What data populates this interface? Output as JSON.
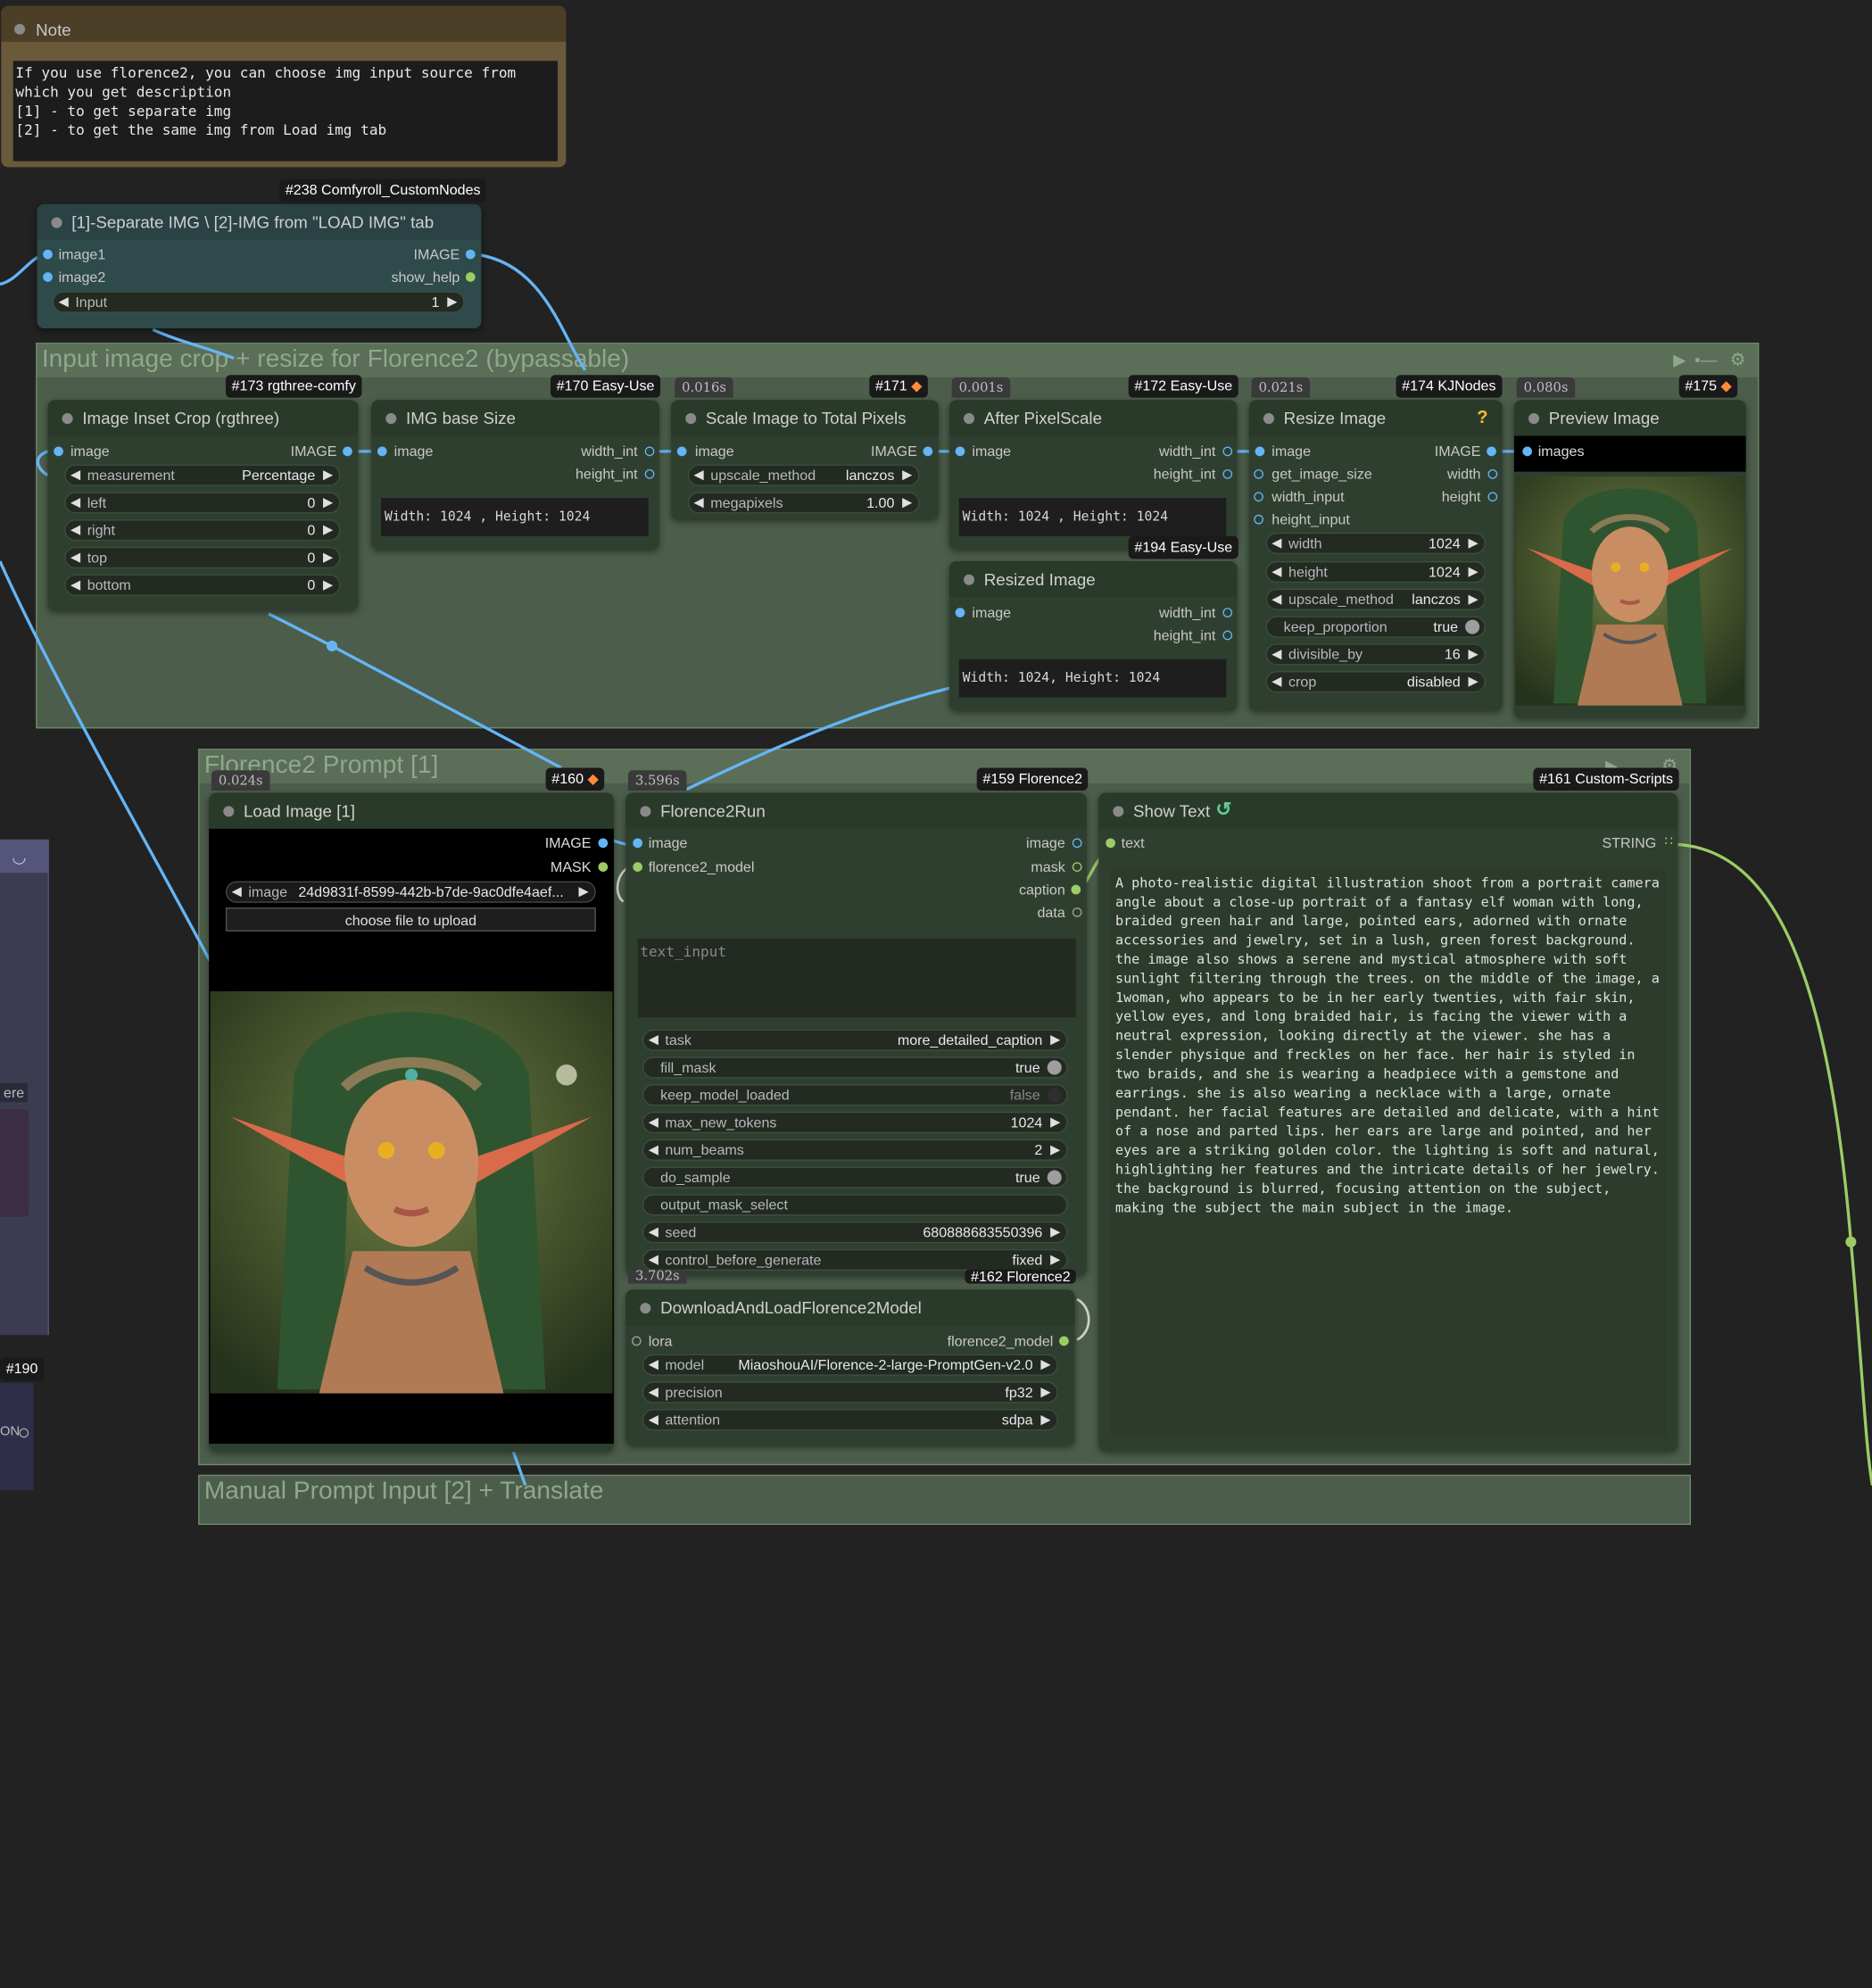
{
  "note": {
    "title": "Note",
    "text": "If you use florence2, you can choose img input source from\nwhich you get description\n[1] - to get separate img\n[2] - to get the same img from Load img tab"
  },
  "switch_node": {
    "badge": "#238 Comfyroll_CustomNodes",
    "title": "[1]-Separate IMG \\ [2]-IMG from \"LOAD IMG\" tab",
    "inputs": [
      "image1",
      "image2"
    ],
    "outputs": [
      "IMAGE",
      "show_help"
    ],
    "widget": {
      "label": "Input",
      "value": "1"
    }
  },
  "group_crop": {
    "title": "Input image crop + resize for Florence2 (bypassable)"
  },
  "group_florence": {
    "title": "Florence2 Prompt [1]"
  },
  "group_bottom": {
    "title": "Manual Prompt Input [2] + Translate"
  },
  "inset_crop": {
    "badge": "#173 rgthree-comfy",
    "title": "Image Inset Crop (rgthree)",
    "input": "image",
    "output": "IMAGE",
    "widgets": [
      {
        "label": "measurement",
        "value": "Percentage"
      },
      {
        "label": "left",
        "value": "0"
      },
      {
        "label": "right",
        "value": "0"
      },
      {
        "label": "top",
        "value": "0"
      },
      {
        "label": "bottom",
        "value": "0"
      }
    ]
  },
  "img_base_size": {
    "badge": "#170 Easy-Use",
    "title": "IMG base Size",
    "input": "image",
    "outputs": [
      "width_int",
      "height_int"
    ],
    "text": "Width: 1024 , Height: 1024"
  },
  "scale_total": {
    "time": "0.016s",
    "badge": "#171",
    "title": "Scale Image to Total Pixels",
    "input": "image",
    "output": "IMAGE",
    "widgets": [
      {
        "label": "upscale_method",
        "value": "lanczos"
      },
      {
        "label": "megapixels",
        "value": "1.00"
      }
    ]
  },
  "after_pixelscale": {
    "time": "0.001s",
    "badge": "#172 Easy-Use",
    "title": "After PixelScale",
    "input": "image",
    "outputs": [
      "width_int",
      "height_int"
    ],
    "text": "Width: 1024 , Height: 1024"
  },
  "resized_image": {
    "badge": "#194 Easy-Use",
    "title": "Resized Image",
    "input": "image",
    "outputs": [
      "width_int",
      "height_int"
    ],
    "text": "Width: 1024, Height: 1024"
  },
  "resize_image": {
    "time": "0.021s",
    "badge": "#174 KJNodes",
    "title": "Resize Image",
    "help": "?",
    "inputs": [
      "image",
      "get_image_size",
      "width_input",
      "height_input"
    ],
    "outputs": [
      "IMAGE",
      "width",
      "height"
    ],
    "widgets": [
      {
        "label": "width",
        "value": "1024"
      },
      {
        "label": "height",
        "value": "1024"
      },
      {
        "label": "upscale_method",
        "value": "lanczos"
      },
      {
        "label": "keep_proportion",
        "value": "true"
      },
      {
        "label": "divisible_by",
        "value": "16"
      },
      {
        "label": "crop",
        "value": "disabled"
      }
    ]
  },
  "preview_image": {
    "time": "0.080s",
    "badge": "#175",
    "title": "Preview Image",
    "input": "images"
  },
  "load_image": {
    "time": "0.024s",
    "badge": "#160",
    "title": "Load Image [1]",
    "outputs": [
      "IMAGE",
      "MASK"
    ],
    "image_widget": {
      "label": "image",
      "value": "24d9831f-8599-442b-b7de-9ac0dfe4aef..."
    },
    "upload_label": "choose file to upload"
  },
  "florence_run": {
    "time": "3.596s",
    "badge": "#159 Florence2",
    "title": "Florence2Run",
    "inputs": [
      "image",
      "florence2_model"
    ],
    "outputs": [
      "image",
      "mask",
      "caption",
      "data"
    ],
    "text_placeholder": "text_input",
    "widgets": [
      {
        "label": "task",
        "value": "more_detailed_caption"
      },
      {
        "label": "fill_mask",
        "value": "true"
      },
      {
        "label": "keep_model_loaded",
        "value": "false"
      },
      {
        "label": "max_new_tokens",
        "value": "1024"
      },
      {
        "label": "num_beams",
        "value": "2"
      },
      {
        "label": "do_sample",
        "value": "true"
      },
      {
        "label": "output_mask_select",
        "value": ""
      },
      {
        "label": "seed",
        "value": "680888683550396"
      },
      {
        "label": "control_before_generate",
        "value": "fixed"
      }
    ]
  },
  "download_model": {
    "time": "3.702s",
    "badge": "#162 Florence2",
    "title": "DownloadAndLoadFlorence2Model",
    "input": "lora",
    "output": "florence2_model",
    "widgets": [
      {
        "label": "model",
        "value": "MiaoshouAI/Florence-2-large-PromptGen-v2.0"
      },
      {
        "label": "precision",
        "value": "fp32"
      },
      {
        "label": "attention",
        "value": "sdpa"
      }
    ]
  },
  "show_text": {
    "badge": "#161 Custom-Scripts",
    "title": "Show Text",
    "input": "text",
    "output": "STRING",
    "text": "A photo-realistic digital illustration shoot from a portrait camera angle about a close-up portrait of a fantasy elf woman with long, braided green hair and large, pointed ears, adorned with ornate accessories and jewelry, set in a lush, green forest background. the image also shows a serene and mystical atmosphere with soft sunlight filtering through the trees. on the middle of the image, a 1woman, who appears to be in her early twenties, with fair skin, yellow eyes, and long braided hair, is facing the viewer with a neutral expression, looking directly at the viewer. she has a slender physique and freckles on her face. her hair is styled in two braids, and she is wearing a headpiece with a gemstone and earrings. she is also wearing a necklace with a large, ornate pendant. her facial features are detailed and delicate, with a hint of a nose and parted lips. her ears are large and pointed, and her eyes are a striking golden color. the lighting is soft and natural, highlighting her features and the intricate details of her jewelry. the background is blurred, focusing attention on the subject, making the subject the main subject in the image."
  },
  "left_edge": {
    "label_ere": "ere",
    "badge": "#190",
    "label_on": "ON"
  },
  "colors": {
    "canvas": "#222222",
    "group": "#4c5e4b",
    "node": "#2f3f2f",
    "link_image": "#64b5f6",
    "link_string": "#9ccc65"
  }
}
